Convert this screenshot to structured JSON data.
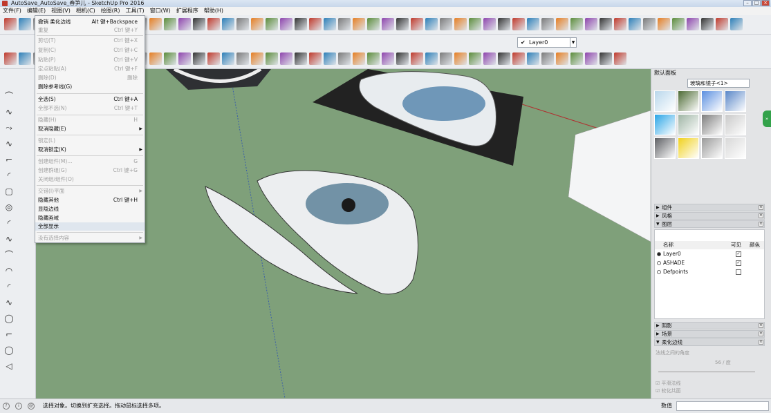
{
  "window": {
    "title": "AutoSave_AutoSave_春笋儿 - SketchUp Pro 2016"
  },
  "menubar": [
    "文件(F)",
    "编辑(E)",
    "视图(V)",
    "相机(C)",
    "绘图(R)",
    "工具(T)",
    "窗口(W)",
    "扩展程序",
    "帮助(H)"
  ],
  "context_menu": {
    "items": [
      {
        "label": "撤销 柔化边线",
        "shortcut": "Alt 键+Backspace",
        "disabled": false
      },
      {
        "label": "重复",
        "shortcut": "Ctrl 键+Y",
        "disabled": true
      },
      {
        "label": "剪切(T)",
        "shortcut": "Ctrl 键+X",
        "disabled": true
      },
      {
        "label": "复制(C)",
        "shortcut": "Ctrl 键+C",
        "disabled": true
      },
      {
        "label": "粘贴(P)",
        "shortcut": "Ctrl 键+V",
        "disabled": true
      },
      {
        "label": "定点粘贴(A)",
        "shortcut": "Ctrl 键+F",
        "disabled": true
      },
      {
        "label": "删除(D)",
        "shortcut": "删除",
        "disabled": true
      },
      {
        "label": "删除参考线(G)",
        "shortcut": "",
        "disabled": false
      },
      {
        "label": "全选(S)",
        "shortcut": "Ctrl 键+A",
        "disabled": false
      },
      {
        "label": "全部不选(N)",
        "shortcut": "Ctrl 键+T",
        "disabled": true
      },
      {
        "label": "隐藏(H)",
        "shortcut": "H",
        "disabled": true
      },
      {
        "label": "取消隐藏(E)",
        "shortcut": "",
        "disabled": false,
        "submenu": true
      },
      {
        "label": "锁定(L)",
        "shortcut": "",
        "disabled": true
      },
      {
        "label": "取消锁定(K)",
        "shortcut": "",
        "disabled": false,
        "submenu": true
      },
      {
        "label": "创建组件(M)...",
        "shortcut": "G",
        "disabled": true
      },
      {
        "label": "创建群组(G)",
        "shortcut": "Ctrl 键+G",
        "disabled": true
      },
      {
        "label": "关闭组/组件(O)",
        "shortcut": "",
        "disabled": true
      },
      {
        "label": "交错(I)平面",
        "shortcut": "",
        "disabled": true,
        "submenu": true
      },
      {
        "label": "隐藏其他",
        "shortcut": "Ctrl 键+H",
        "disabled": false
      },
      {
        "label": "显隐边线",
        "shortcut": "",
        "disabled": false
      },
      {
        "label": "隐藏画域",
        "shortcut": "",
        "disabled": false
      },
      {
        "label": "全部显示",
        "shortcut": "",
        "disabled": false,
        "highlighted": true
      },
      {
        "label": "没有选择内容",
        "shortcut": "",
        "disabled": true,
        "submenu": true
      }
    ]
  },
  "layer_toolbar": {
    "current_layer": "Layer0"
  },
  "tray": {
    "title": "默认面板",
    "materials": {
      "collection": "玻璃和镜子<1>"
    },
    "panels": [
      "组件",
      "风格",
      "图层"
    ],
    "bottom_panels": [
      "阴影",
      "场景",
      "柔化边线"
    ],
    "layers": {
      "col_name": "名称",
      "col_visible": "可见",
      "col_color": "颜色",
      "rows": [
        {
          "name": "Layer0",
          "active": true,
          "visible": true
        },
        {
          "name": "ASHADE",
          "active": false,
          "visible": true
        },
        {
          "name": "Defpoints",
          "active": false,
          "visible": false
        }
      ]
    },
    "soften": {
      "label": "法线之间的角度",
      "angle": "56",
      "unit": "度",
      "smooth": "平滑法线",
      "coplanar": "软化共面"
    }
  },
  "status": {
    "text": "选择对象。切换到扩充选择。拖动鼠标选择多项。",
    "measure_label": "数值"
  },
  "colors": {
    "viewport": "#7fa07a",
    "accent": "#33a24a"
  }
}
